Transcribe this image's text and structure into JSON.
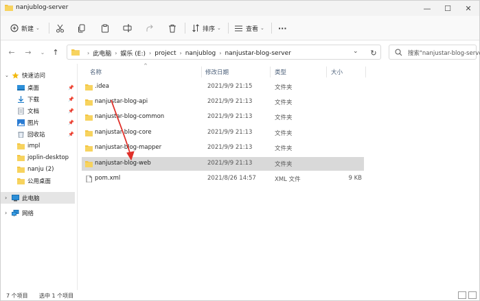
{
  "window": {
    "title": "nanjublog-server"
  },
  "window_controls": {
    "minimize": "—",
    "maximize": "☐",
    "close": "✕"
  },
  "commandbar": {
    "new_label": "新建",
    "sort_label": "排序",
    "view_label": "查看",
    "more_label": "···"
  },
  "address": {
    "crumbs": [
      "此电脑",
      "娱乐 (E:)",
      "project",
      "nanjublog",
      "nanjustar-blog-server"
    ],
    "search_placeholder": "搜索\"nanjustar-blog-server\""
  },
  "nav": {
    "quick_access": "快速访问",
    "items": [
      "桌面",
      "下载",
      "文档",
      "图片",
      "回收站",
      "impl",
      "joplin-desktop",
      "nanju (2)",
      "公用桌面"
    ],
    "this_pc": "此电脑",
    "network": "网络"
  },
  "columns": {
    "name": "名称",
    "date": "修改日期",
    "type": "类型",
    "size": "大小"
  },
  "files": [
    {
      "name": ".idea",
      "date": "2021/9/9 21:15",
      "type": "文件夹",
      "size": ""
    },
    {
      "name": "nanjustar-blog-api",
      "date": "2021/9/9 21:13",
      "type": "文件夹",
      "size": ""
    },
    {
      "name": "nanjustar-blog-common",
      "date": "2021/9/9 21:13",
      "type": "文件夹",
      "size": ""
    },
    {
      "name": "nanjustar-blog-core",
      "date": "2021/9/9 21:13",
      "type": "文件夹",
      "size": ""
    },
    {
      "name": "nanjustar-blog-mapper",
      "date": "2021/9/9 21:13",
      "type": "文件夹",
      "size": ""
    },
    {
      "name": "nanjustar-blog-web",
      "date": "2021/9/9 21:13",
      "type": "文件夹",
      "size": ""
    },
    {
      "name": "pom.xml",
      "date": "2021/8/26 14:57",
      "type": "XML 文件",
      "size": "9 KB"
    }
  ],
  "status": {
    "count": "7 个项目",
    "selected": "选中 1 个项目"
  },
  "colors": {
    "folder": "#f4c542",
    "selection": "#d9d9d9",
    "annotation_arrow": "#e0302a"
  }
}
